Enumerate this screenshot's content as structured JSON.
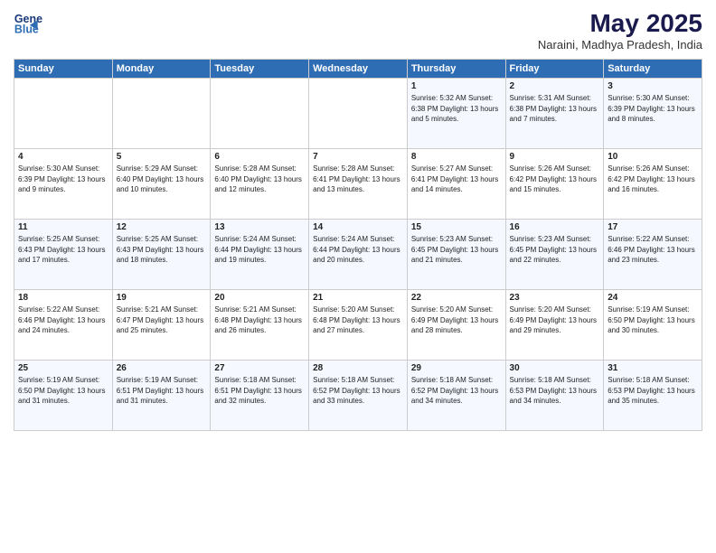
{
  "logo": {
    "line1": "General",
    "line2": "Blue"
  },
  "title": "May 2025",
  "location": "Naraini, Madhya Pradesh, India",
  "weekdays": [
    "Sunday",
    "Monday",
    "Tuesday",
    "Wednesday",
    "Thursday",
    "Friday",
    "Saturday"
  ],
  "weeks": [
    [
      {
        "day": "",
        "info": ""
      },
      {
        "day": "",
        "info": ""
      },
      {
        "day": "",
        "info": ""
      },
      {
        "day": "",
        "info": ""
      },
      {
        "day": "1",
        "info": "Sunrise: 5:32 AM\nSunset: 6:38 PM\nDaylight: 13 hours\nand 5 minutes."
      },
      {
        "day": "2",
        "info": "Sunrise: 5:31 AM\nSunset: 6:38 PM\nDaylight: 13 hours\nand 7 minutes."
      },
      {
        "day": "3",
        "info": "Sunrise: 5:30 AM\nSunset: 6:39 PM\nDaylight: 13 hours\nand 8 minutes."
      }
    ],
    [
      {
        "day": "4",
        "info": "Sunrise: 5:30 AM\nSunset: 6:39 PM\nDaylight: 13 hours\nand 9 minutes."
      },
      {
        "day": "5",
        "info": "Sunrise: 5:29 AM\nSunset: 6:40 PM\nDaylight: 13 hours\nand 10 minutes."
      },
      {
        "day": "6",
        "info": "Sunrise: 5:28 AM\nSunset: 6:40 PM\nDaylight: 13 hours\nand 12 minutes."
      },
      {
        "day": "7",
        "info": "Sunrise: 5:28 AM\nSunset: 6:41 PM\nDaylight: 13 hours\nand 13 minutes."
      },
      {
        "day": "8",
        "info": "Sunrise: 5:27 AM\nSunset: 6:41 PM\nDaylight: 13 hours\nand 14 minutes."
      },
      {
        "day": "9",
        "info": "Sunrise: 5:26 AM\nSunset: 6:42 PM\nDaylight: 13 hours\nand 15 minutes."
      },
      {
        "day": "10",
        "info": "Sunrise: 5:26 AM\nSunset: 6:42 PM\nDaylight: 13 hours\nand 16 minutes."
      }
    ],
    [
      {
        "day": "11",
        "info": "Sunrise: 5:25 AM\nSunset: 6:43 PM\nDaylight: 13 hours\nand 17 minutes."
      },
      {
        "day": "12",
        "info": "Sunrise: 5:25 AM\nSunset: 6:43 PM\nDaylight: 13 hours\nand 18 minutes."
      },
      {
        "day": "13",
        "info": "Sunrise: 5:24 AM\nSunset: 6:44 PM\nDaylight: 13 hours\nand 19 minutes."
      },
      {
        "day": "14",
        "info": "Sunrise: 5:24 AM\nSunset: 6:44 PM\nDaylight: 13 hours\nand 20 minutes."
      },
      {
        "day": "15",
        "info": "Sunrise: 5:23 AM\nSunset: 6:45 PM\nDaylight: 13 hours\nand 21 minutes."
      },
      {
        "day": "16",
        "info": "Sunrise: 5:23 AM\nSunset: 6:45 PM\nDaylight: 13 hours\nand 22 minutes."
      },
      {
        "day": "17",
        "info": "Sunrise: 5:22 AM\nSunset: 6:46 PM\nDaylight: 13 hours\nand 23 minutes."
      }
    ],
    [
      {
        "day": "18",
        "info": "Sunrise: 5:22 AM\nSunset: 6:46 PM\nDaylight: 13 hours\nand 24 minutes."
      },
      {
        "day": "19",
        "info": "Sunrise: 5:21 AM\nSunset: 6:47 PM\nDaylight: 13 hours\nand 25 minutes."
      },
      {
        "day": "20",
        "info": "Sunrise: 5:21 AM\nSunset: 6:48 PM\nDaylight: 13 hours\nand 26 minutes."
      },
      {
        "day": "21",
        "info": "Sunrise: 5:20 AM\nSunset: 6:48 PM\nDaylight: 13 hours\nand 27 minutes."
      },
      {
        "day": "22",
        "info": "Sunrise: 5:20 AM\nSunset: 6:49 PM\nDaylight: 13 hours\nand 28 minutes."
      },
      {
        "day": "23",
        "info": "Sunrise: 5:20 AM\nSunset: 6:49 PM\nDaylight: 13 hours\nand 29 minutes."
      },
      {
        "day": "24",
        "info": "Sunrise: 5:19 AM\nSunset: 6:50 PM\nDaylight: 13 hours\nand 30 minutes."
      }
    ],
    [
      {
        "day": "25",
        "info": "Sunrise: 5:19 AM\nSunset: 6:50 PM\nDaylight: 13 hours\nand 31 minutes."
      },
      {
        "day": "26",
        "info": "Sunrise: 5:19 AM\nSunset: 6:51 PM\nDaylight: 13 hours\nand 31 minutes."
      },
      {
        "day": "27",
        "info": "Sunrise: 5:18 AM\nSunset: 6:51 PM\nDaylight: 13 hours\nand 32 minutes."
      },
      {
        "day": "28",
        "info": "Sunrise: 5:18 AM\nSunset: 6:52 PM\nDaylight: 13 hours\nand 33 minutes."
      },
      {
        "day": "29",
        "info": "Sunrise: 5:18 AM\nSunset: 6:52 PM\nDaylight: 13 hours\nand 34 minutes."
      },
      {
        "day": "30",
        "info": "Sunrise: 5:18 AM\nSunset: 6:53 PM\nDaylight: 13 hours\nand 34 minutes."
      },
      {
        "day": "31",
        "info": "Sunrise: 5:18 AM\nSunset: 6:53 PM\nDaylight: 13 hours\nand 35 minutes."
      }
    ]
  ]
}
